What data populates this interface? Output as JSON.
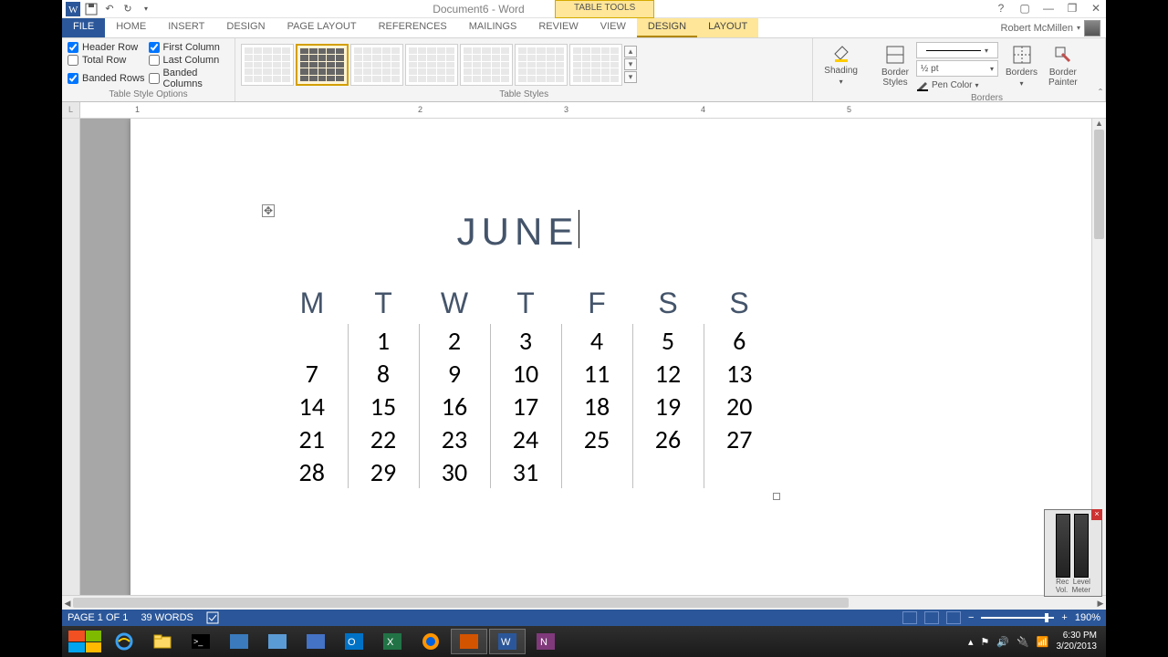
{
  "titlebar": {
    "doc_title": "Document6 - Word",
    "table_tools": "TABLE TOOLS"
  },
  "window_buttons": {
    "help": "?",
    "opts": "▢",
    "min": "—",
    "max": "❐",
    "close": "✕"
  },
  "user": {
    "name": "Robert McMillen"
  },
  "tabs": [
    "FILE",
    "HOME",
    "INSERT",
    "DESIGN",
    "PAGE LAYOUT",
    "REFERENCES",
    "MAILINGS",
    "REVIEW",
    "VIEW",
    "DESIGN",
    "LAYOUT"
  ],
  "ribbon": {
    "table_style_options": {
      "header_row": "Header Row",
      "total_row": "Total Row",
      "banded_rows": "Banded Rows",
      "first_col": "First Column",
      "last_col": "Last Column",
      "banded_cols": "Banded Columns",
      "label": "Table Style Options"
    },
    "table_styles_label": "Table Styles",
    "shading_label": "Shading",
    "border_styles": "Border\nStyles",
    "pen_weight": "½ pt",
    "pen_color": "Pen Color",
    "borders_btn": "Borders",
    "border_painter": "Border\nPainter",
    "borders_label": "Borders"
  },
  "ruler": {
    "corner": "L",
    "marks": [
      "1",
      "2",
      "3",
      "4",
      "5"
    ]
  },
  "calendar": {
    "title": "JUNE",
    "days": [
      "M",
      "T",
      "W",
      "T",
      "F",
      "S",
      "S"
    ],
    "rows": [
      [
        "",
        "1",
        "2",
        "3",
        "4",
        "5",
        "6"
      ],
      [
        "7",
        "8",
        "9",
        "10",
        "11",
        "12",
        "13"
      ],
      [
        "14",
        "15",
        "16",
        "17",
        "18",
        "19",
        "20"
      ],
      [
        "21",
        "22",
        "23",
        "24",
        "25",
        "26",
        "27"
      ],
      [
        "28",
        "29",
        "30",
        "31",
        "",
        "",
        ""
      ]
    ]
  },
  "statusbar": {
    "page": "PAGE 1 OF 1",
    "words": "39 WORDS",
    "zoom": "190%"
  },
  "clock": {
    "time": "6:30 PM",
    "date": "3/20/2013"
  },
  "level_meter": {
    "rec": "Rec",
    "level": "Level",
    "vol": "Vol.",
    "meter": "Meter"
  }
}
